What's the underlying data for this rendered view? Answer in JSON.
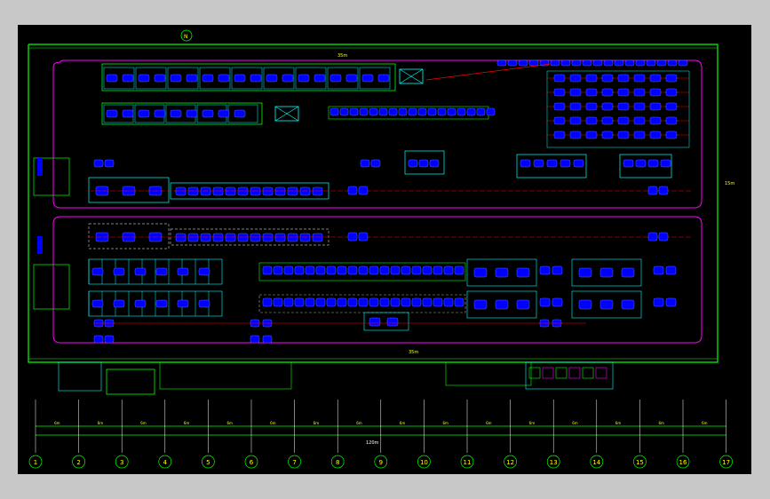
{
  "colors": {
    "background": "#000000",
    "frame": "#c8c8c8",
    "wall": "#00ff00",
    "conveyor": "#ff00ff",
    "equipment": "#0000ff",
    "outline": "#00ffff",
    "line_red": "#ff0000",
    "label": "#ffff00",
    "grid": "#ffffff"
  },
  "labels": {
    "top_wall_dim": "35m",
    "bottom_wall_dim": "35m",
    "right_wall_dim": "15m",
    "bay_dim": "6m",
    "total_dim": "120m",
    "north_symbol": "N"
  },
  "grid_axes": [
    "1",
    "2",
    "3",
    "4",
    "5",
    "6",
    "7",
    "8",
    "9",
    "10",
    "11",
    "12",
    "13",
    "14",
    "15",
    "16",
    "17"
  ]
}
